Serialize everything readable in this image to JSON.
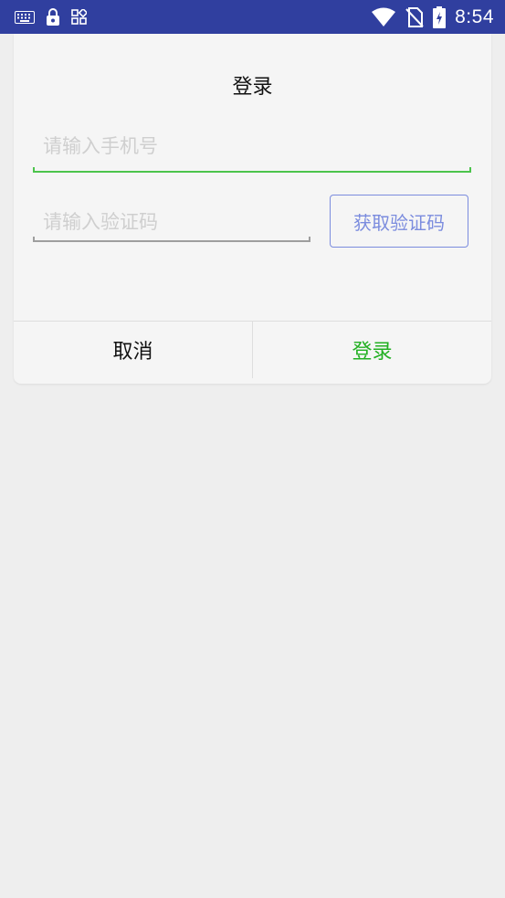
{
  "status_bar": {
    "time": "8:54",
    "background": "#303f9f",
    "left_icons": [
      "keyboard-icon",
      "lock-icon",
      "apps-icon"
    ],
    "right_icons": [
      "wifi-icon",
      "no-sim-icon",
      "battery-charging-icon"
    ]
  },
  "dialog": {
    "title": "登录",
    "phone_input": {
      "placeholder": "请输入手机号",
      "value": "",
      "focused": true,
      "accent": "#4cc44c"
    },
    "code_input": {
      "placeholder": "请输入验证码",
      "value": ""
    },
    "get_code_button": {
      "label": "获取验证码",
      "color": "#7b8cde"
    },
    "cancel_button": {
      "label": "取消"
    },
    "login_button": {
      "label": "登录",
      "color": "#22b022"
    }
  }
}
